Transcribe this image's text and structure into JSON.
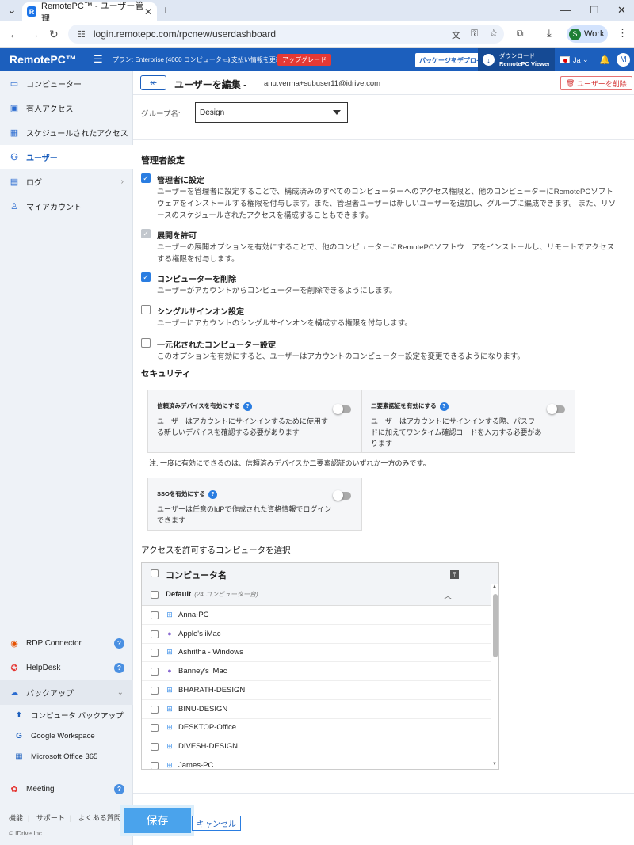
{
  "browser": {
    "tab_title": "RemotePC™ - ユーザー管理",
    "tab_favicon": "R",
    "url": "login.remotepc.com/rpcnew/userdashboard",
    "profile_initial": "S",
    "profile_label": "Work"
  },
  "topbar": {
    "logo": "RemotePC™",
    "plan": "プラン: Enterprise (4000 コンピューター)",
    "payment_update": "支払い情報を更新",
    "upgrade": "アップグレード",
    "deploy_package": "パッケージをデプロイ",
    "download_line1": "ダウンロード",
    "download_line2": "RemotePC Viewer",
    "language": "Ja",
    "user_initial": "M"
  },
  "sidebar": {
    "items": [
      {
        "label": "コンピューター",
        "icon": "monitor-icon"
      },
      {
        "label": "有人アクセス",
        "icon": "attended-icon"
      },
      {
        "label": "スケジュールされたアクセス",
        "icon": "calendar-icon"
      },
      {
        "label": "ユーザー",
        "icon": "users-icon"
      },
      {
        "label": "ログ",
        "icon": "log-icon"
      },
      {
        "label": "マイアカウント",
        "icon": "account-icon"
      }
    ],
    "rdp_connector": "RDP Connector",
    "helpdesk": "HelpDesk",
    "backup": "バックアップ",
    "backup_sub": [
      "コンピュータ バックアップ",
      "Google Workspace",
      "Microsoft Office 365"
    ],
    "meeting": "Meeting",
    "footer_links": [
      "機能",
      "サポート",
      "よくある質問"
    ],
    "copyright": "© IDrive Inc."
  },
  "header": {
    "title": "ユーザーを編集 -",
    "email": "anu.verma+subuser11@idrive.com",
    "delete_user": "ユーザーを削除"
  },
  "group": {
    "label": "グループ名:",
    "value": "Design"
  },
  "admin": {
    "section_title": "管理者設定",
    "permissions": [
      {
        "title": "管理者に設定",
        "state": "checked",
        "desc": "ユーザーを管理者に設定することで、構成済みのすべてのコンピューターへのアクセス権限と、他のコンピューターにRemotePCソフトウェアをインストールする権限を付与します。また、管理者ユーザーは新しいユーザーを追加し、グループに編成できます。 また、リソースのスケジュールされたアクセスを構成することもできます。"
      },
      {
        "title": "展開を許可",
        "state": "disabled",
        "desc": "ユーザーの展開オプションを有効にすることで、他のコンピューターにRemotePCソフトウェアをインストールし、リモートでアクセスする権限を付与します。"
      },
      {
        "title": "コンピューターを削除",
        "state": "checked",
        "desc": "ユーザーがアカウントからコンピューターを削除できるようにします。"
      },
      {
        "title": "シングルサインオン設定",
        "state": "unchecked",
        "desc": "ユーザーにアカウントのシングルサインオンを構成する権限を付与します。"
      },
      {
        "title": "一元化されたコンピューター設定",
        "state": "unchecked",
        "desc": "このオプションを有効にすると、ユーザーはアカウントのコンピューター設定を変更できるようになります。"
      }
    ]
  },
  "security": {
    "section_title": "セキュリティ",
    "trusted_title": "信頼済みデバイスを有効にする",
    "trusted_desc1": "ユーザーはアカウントにサインインするために使用す",
    "trusted_desc2": "る新しいデバイスを確認する必要があります",
    "twofa_title": "二要素認証を有効にする",
    "twofa_desc1": "ユーザーはアカウントにサインインする際、パスワー",
    "twofa_desc2": "ドに加えてワンタイム確認コードを入力する必要があ",
    "twofa_desc3": "ります",
    "note": "注: 一度に有効にできるのは、信頼済みデバイスか二要素認証のいずれか一方のみです。",
    "sso_title": "SSOを有効にする",
    "sso_desc1": "ユーザーは任意のIdPで作成された資格情報でログイン",
    "sso_desc2": "できます",
    "help": "?"
  },
  "computers": {
    "section_title": "アクセスを許可するコンピュータを選択",
    "column_header": "コンピュータ名",
    "group_name": "Default",
    "group_count": "(24 コンピューター台)",
    "rows": [
      {
        "name": "Anna-PC",
        "os": "windows-icon"
      },
      {
        "name": "Apple's iMac",
        "os": "apple-icon"
      },
      {
        "name": "Ashritha - Windows",
        "os": "windows-icon"
      },
      {
        "name": "Banney's iMac",
        "os": "apple-icon"
      },
      {
        "name": "BHARATH-DESIGN",
        "os": "windows-icon"
      },
      {
        "name": "BINU-DESIGN",
        "os": "windows-icon"
      },
      {
        "name": "DESKTOP-Office",
        "os": "windows-icon"
      },
      {
        "name": "DIVESH-DESIGN",
        "os": "windows-icon"
      },
      {
        "name": "James-PC",
        "os": "windows-icon"
      }
    ]
  },
  "actions": {
    "save": "保存",
    "cancel": "キャンセル"
  }
}
